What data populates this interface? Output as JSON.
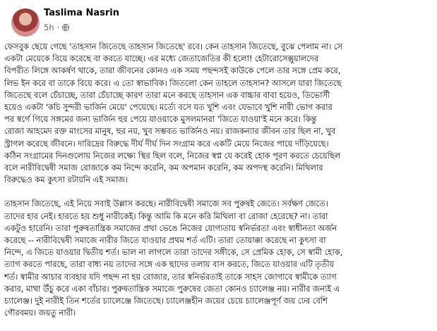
{
  "post": {
    "author": "Taslima Nasrin",
    "time": "5h",
    "dot": "·",
    "visibility_icon": "globe-icon",
    "paragraphs": [
      [
        "ফেসবুক ছেয়ে গেছে 'তাহসান জিতেছে তাহসান জিতেছে' রবে। কেন তাহসান জিতেছে, বুঝে পেলাম না। সে",
        "একটা মেয়েকে বিয়ে করেছে বা করতে যাচ্ছে। এর মধ্যে জেতাজেতির কী হলো! হেটারোসেক্সুয়ালদের",
        "বিপরীত লিঙ্গে আকর্ষণ থাকে, তারা জীবনের কোনও এক সময় পছন্দসই কাউকে পেলে তার সঙ্গে প্রেম করে,",
        "লিভ ইন করে বা তাকে বিয়ে করে। এ তো স্বাভাবিক। জিতলো কেন তাহলে তাহসান? আসলে যারা জিতেছে",
        "জিতেছে বলে চেঁচাচ্ছে, তারা চেঁচাচ্ছে কারণ তারা মনে করছে তাহসান এক বাচ্চার বাবা হয়েও, ডিভোর্সী",
        "হয়েও একটা 'কচি সুন্দরী ভার্জিন মেয়ে' পেয়েছে। মর্ত্যে বসে যত খুশি এবং যেভাবে খুশি নারী ভোগ করার",
        "পর স্বর্গে গিয়ে সঙ্গমের জন্য ভার্জিন হুর পেয়ে যাওয়াকে মুসলমানরা 'জিতে যাওয়া'ই মনে করে। কিন্তু",
        "রোজা আহমেদ রক্ত মাংসের মানুষ, হুর নয়, খুব সম্ভবত ভার্জিনও নয়। রাজকন্যার জীবন তার ছিল না, খুব",
        "স্ট্রাগল করেছে জীবনে। দারিদ্রের বিরুদ্ধে দীর্ঘ দীর্ঘ দিন সংগ্রাম করে একটি মেয়ে নিজের পায়ে দাঁড়িয়েছে।",
        "কঠিন সংগ্রামের দিনগুলোয় নিজের লক্ষ্যে স্থির ছিল বলে, নিজের স্বপ্ন যে করেই হোক পূরণ করতে চেয়েছিল",
        "বলে নারীবিদ্বেষী সমাজ রোজাকে কম নিন্দে করেনি, কম অপমান করেনি, কম অপদস্থ করেনি। মিথিলার",
        "বিরুদ্ধেও কম কুৎসা রটায়নি এই সমাজ।"
      ],
      [
        "তাহসান জিতেছে, এই নিয়ে সবাই উল্লাস করছে। নারীবিদ্বেষী সমাজে সব পুরুষই জেতে। সর্বক্ষণ জেতে।",
        "তাদের হার নেই। হারতে হয় শুধু নারীকেই। কিন্তু আমি কি মনে করি মিথিলা বা রোজা হেরেছে? না। তারা",
        "একটুও হারেনি। তারা পুরুষতান্ত্রিক সমাজের প্রথা ভেঙে নিজের যোগ্যতায় স্বনির্ভরতা এবং স্বাধীনতা অর্জন",
        "করেছে -- নারীবিদ্বেষী সমাজে নারীর জিতে যাওয়ার প্রথম শর্ত এটি। তারা তোয়াক্কা করেছে না কুৎসা বা",
        "নিন্দে, এ জিতে যাওয়ার দ্বিতীয় শর্ত। ভাল না লাগলে তারা তাদের সঙ্গীকে, সে প্রেমিক হোক, সে স্বামী হোক,",
        "ত্যাগ করতে পারছে, তারা বাধ্য নয় তাদের সঙ্গে এক ছাদের তলায় বাস করতে, জিতে যাওয়ার এটি তৃতীয়",
        "শর্ত। স্বামীর আচার ব্যবহার যদি পছন্দ না হয় রোজার, তার স্বনির্ভরতাই তাকে সাহস জোগাবে স্বামীকে ত্যাগ",
        "করার, মাথা উঁচু করে একা বাঁচার। পুরুষতান্ত্রিক সমাজে পুরুষের জেতা কোনও চ্যালেঞ্জ নয়। নারীর জন্যই এ",
        "চ্যালেঞ্জ। দুই নারীই তিন শর্তের চ্যালেঞ্জে জিতেছে। চ্যালেঞ্জহীন জয়ের চেয়ে চ্যালেঞ্জপূর্ণ জয় ঢের বেশি",
        "গৌরবময়। জয়তু নারী।"
      ]
    ]
  }
}
